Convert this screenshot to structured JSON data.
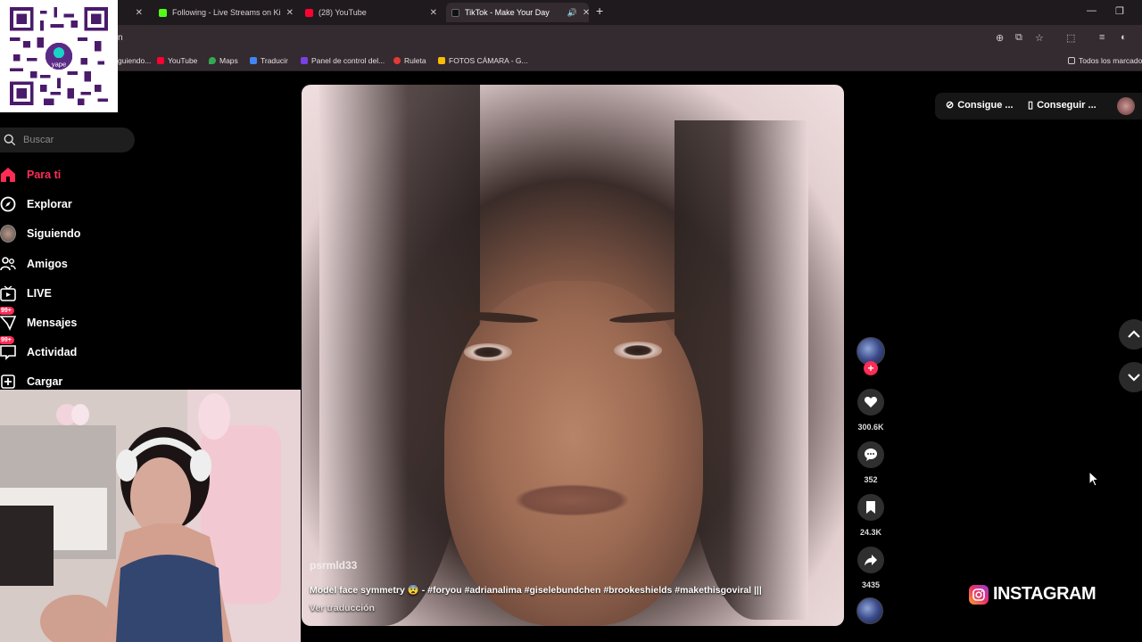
{
  "browser": {
    "tabs": [
      {
        "title": "Following - Live Streams on Ki",
        "favicon_color": "#53fc18"
      },
      {
        "title": "(28) YouTube",
        "favicon_color": "#ff0033"
      },
      {
        "title": "TikTok - Make Your Day",
        "favicon_color": "#111111"
      }
    ],
    "new_tab": "+",
    "address_text": "n",
    "bookmarks": [
      {
        "label": "guiendo...",
        "color": "#888888"
      },
      {
        "label": "YouTube",
        "color": "#ff0033"
      },
      {
        "label": "Maps",
        "color": "#34a853"
      },
      {
        "label": "Traducir",
        "color": "#4285f4"
      },
      {
        "label": "Panel de control del...",
        "color": "#7b3fe4"
      },
      {
        "label": "Ruleta",
        "color": "#e53935"
      },
      {
        "label": "FOTOS CÁMARA - G...",
        "color": "#fbbc04"
      }
    ],
    "all_bookmarks": "Todos los marcado"
  },
  "qr": {
    "brand": "yape"
  },
  "sidebar": {
    "search_placeholder": "Buscar",
    "items": [
      {
        "label": "Para ti",
        "icon": "home-icon"
      },
      {
        "label": "Explorar",
        "icon": "compass-icon"
      },
      {
        "label": "Siguiendo",
        "icon": "following-avatar-icon"
      },
      {
        "label": "Amigos",
        "icon": "friends-icon"
      },
      {
        "label": "LIVE",
        "icon": "live-icon"
      },
      {
        "label": "Mensajes",
        "icon": "messages-icon",
        "badge": "99+"
      },
      {
        "label": "Actividad",
        "icon": "activity-icon",
        "badge": "99+"
      },
      {
        "label": "Cargar",
        "icon": "upload-icon"
      }
    ]
  },
  "video": {
    "username": "psrmld33",
    "description": "Model face symmetry 😨 - #foryou #adrianalima #giselebundchen #brookeshields #makethisgoviral |||",
    "translate": "Ver traducción"
  },
  "actions": {
    "likes": "300.6K",
    "comments": "352",
    "saves": "24.3K",
    "shares": "3435"
  },
  "topright": {
    "coins": "Consigue ...",
    "app": "Conseguir ..."
  },
  "overlay": {
    "instagram": "INSTAGRAM"
  },
  "colors": {
    "accent": "#fe2c55"
  }
}
